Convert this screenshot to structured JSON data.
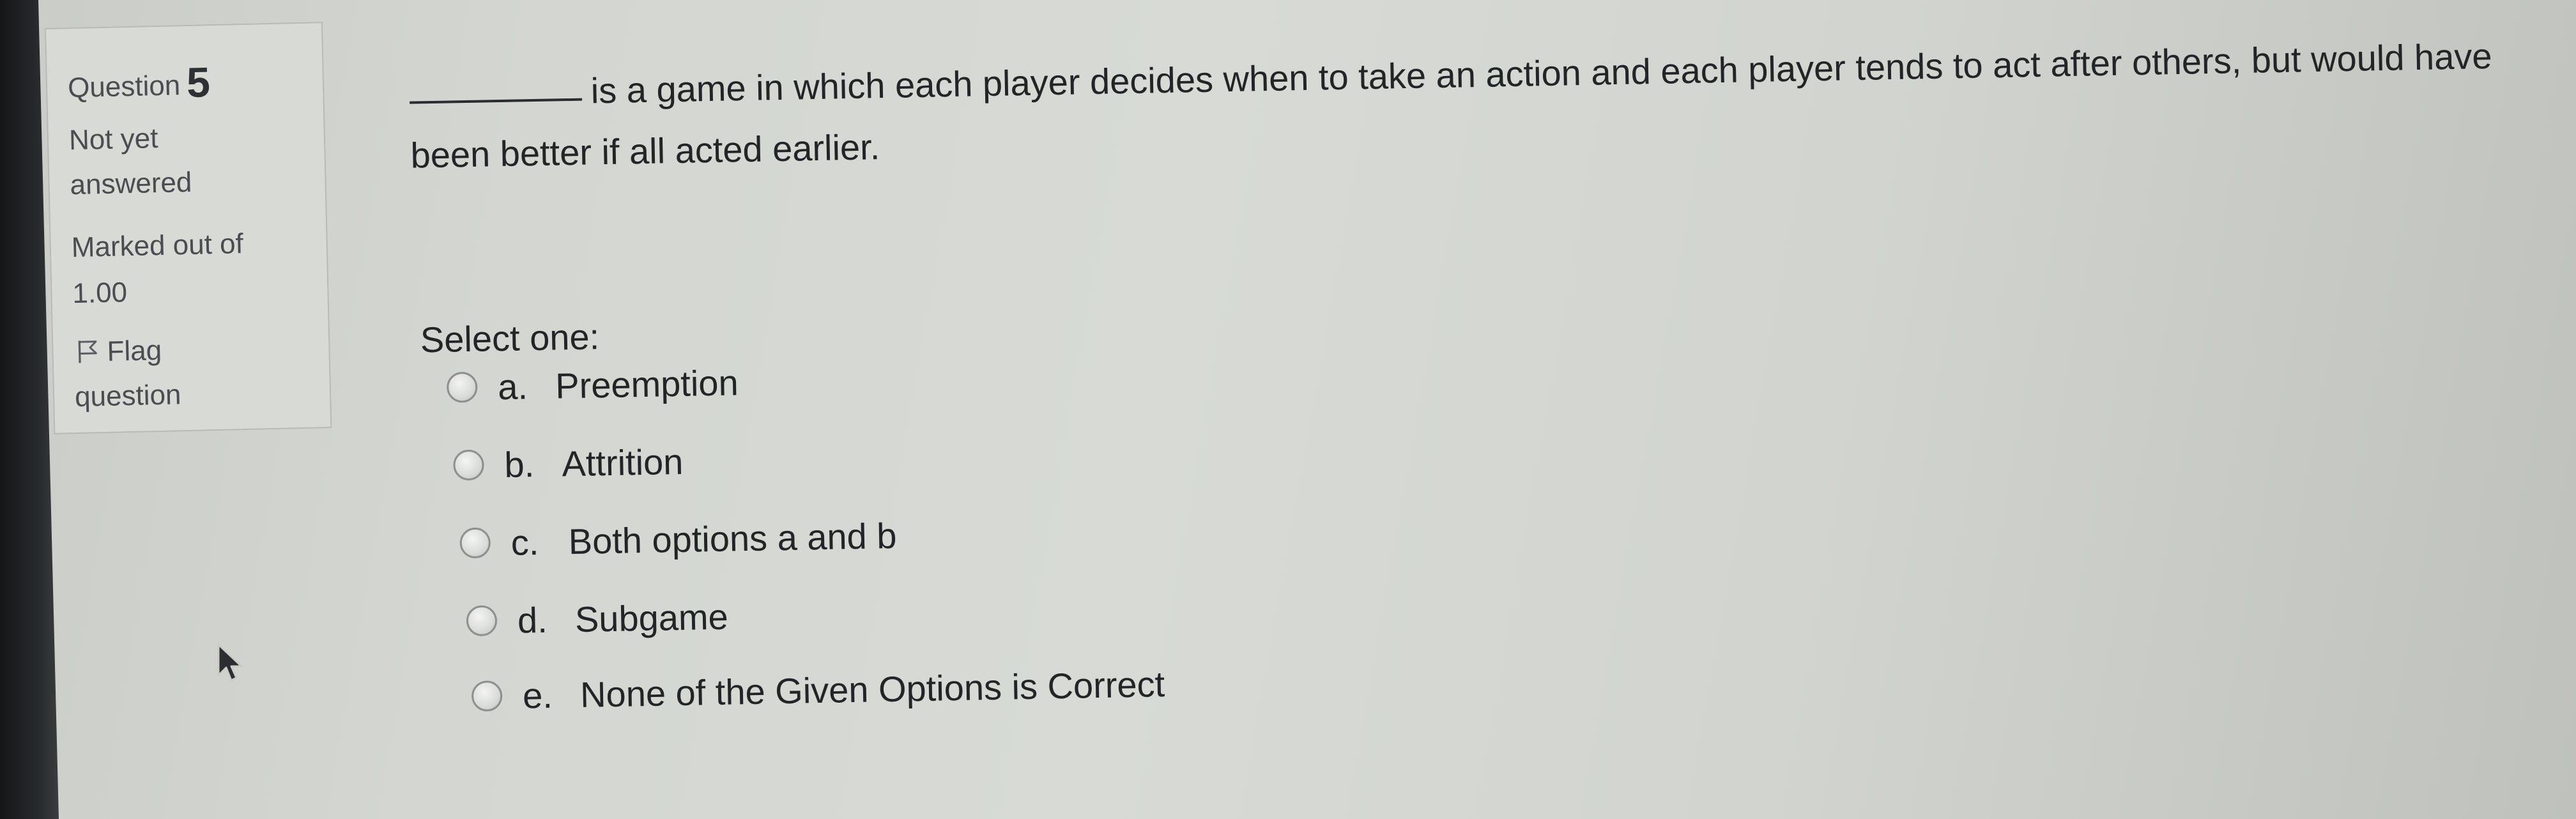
{
  "info": {
    "question_label": "Question",
    "question_number": "5",
    "state_line1": "Not yet",
    "state_line2": "answered",
    "marked_line1": "Marked out of",
    "marked_line2": "1.00",
    "flag_line1": "Flag",
    "flag_line2": "question",
    "flag_icon": "flag-outline-icon"
  },
  "question": {
    "text": "is a game in which each player decides when to take an action and each player tends to act after others, but would have been better if all acted earlier.",
    "select_label": "Select one:",
    "options": [
      {
        "letter": "a.",
        "label": "Preemption"
      },
      {
        "letter": "b.",
        "label": "Attrition"
      },
      {
        "letter": "c.",
        "label": "Both options a and b"
      },
      {
        "letter": "d.",
        "label": "Subgame"
      },
      {
        "letter": "e.",
        "label": "None of the Given Options is Correct"
      }
    ]
  },
  "cursor_icon": "mouse-pointer-icon"
}
